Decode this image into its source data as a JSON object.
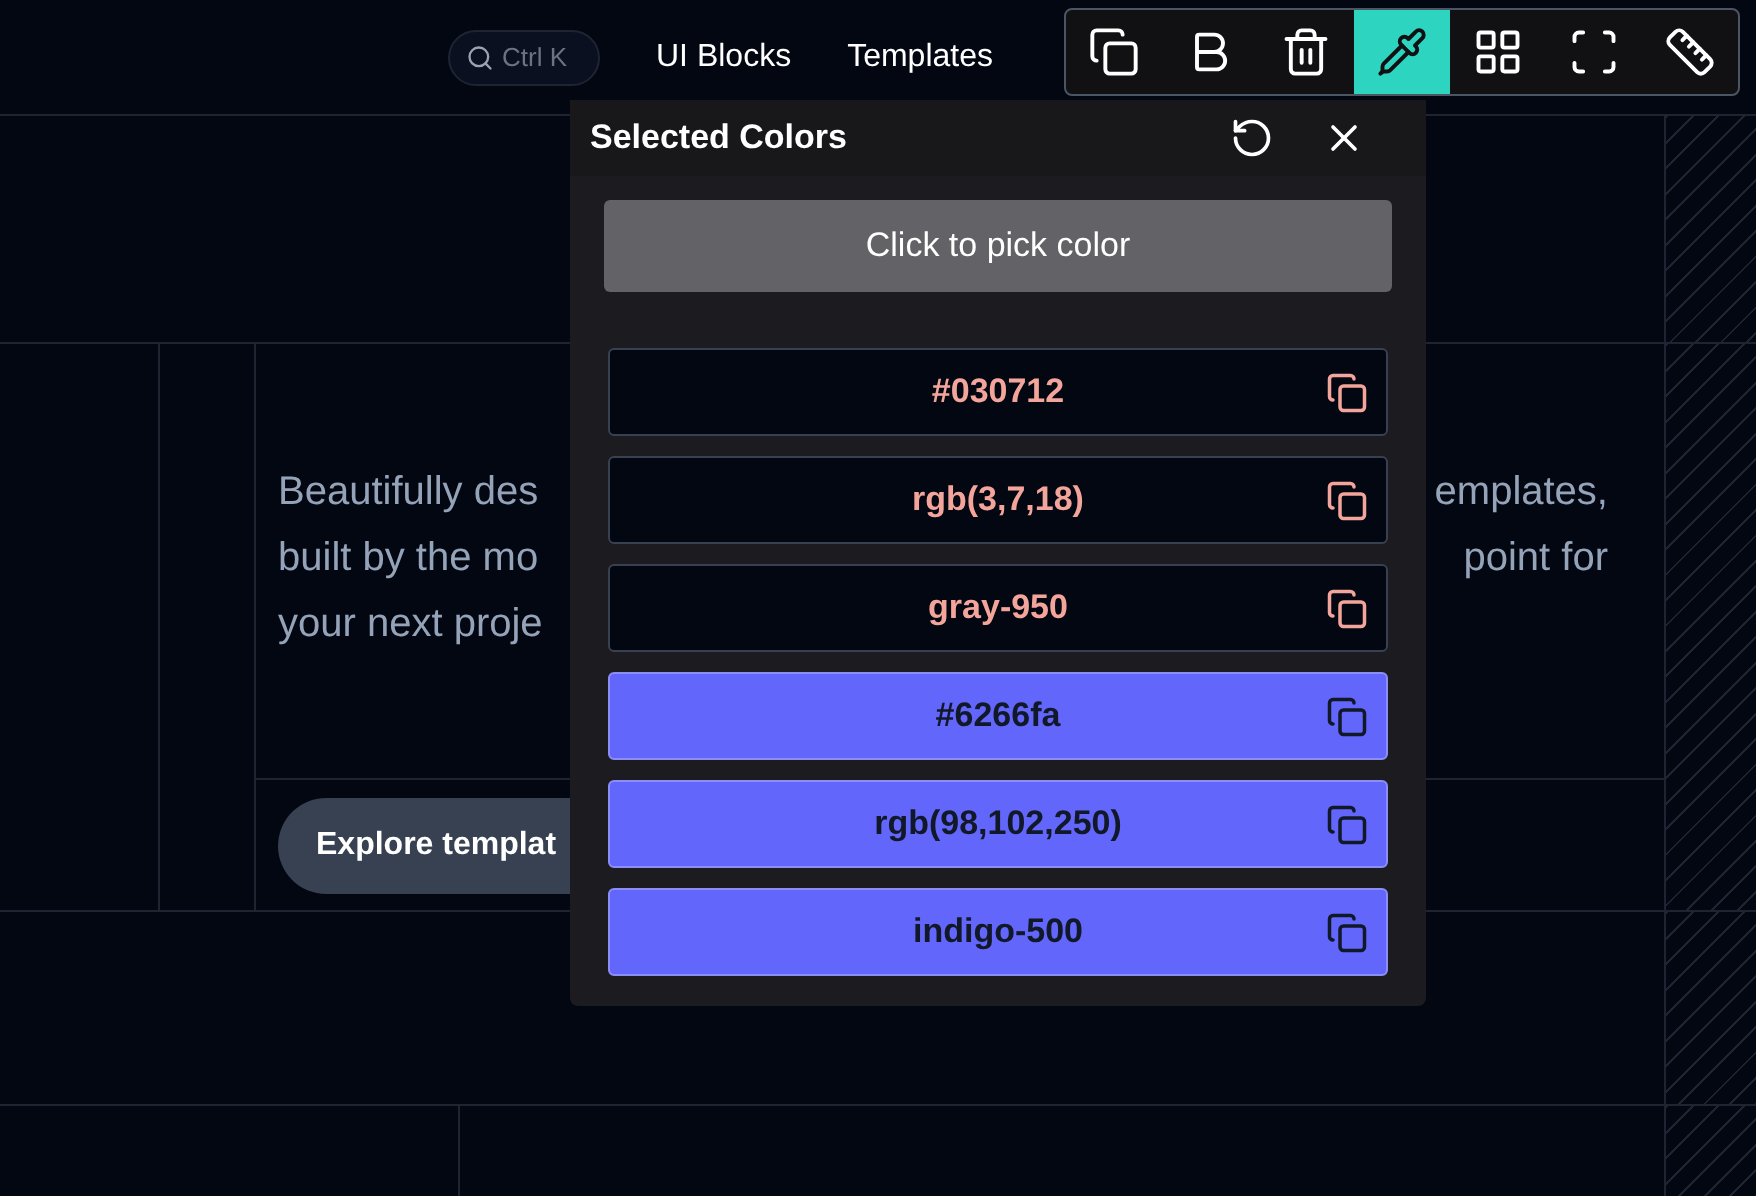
{
  "header": {
    "search": {
      "placeholder": "Ctrl K"
    },
    "nav": [
      "UI Blocks",
      "Templates"
    ]
  },
  "hero": {
    "left_lines": [
      "Beautifully des",
      "built by the mo",
      "your next proje"
    ],
    "right_lines": [
      "emplates,",
      "point for"
    ],
    "button": "Explore templat"
  },
  "toolbar": {
    "tools": [
      {
        "kind": "copy",
        "selected": false
      },
      {
        "kind": "bold",
        "selected": false
      },
      {
        "kind": "trash",
        "selected": false
      },
      {
        "kind": "pipette",
        "selected": true
      },
      {
        "kind": "grid",
        "selected": false
      },
      {
        "kind": "frame",
        "selected": false
      },
      {
        "kind": "ruler",
        "selected": false
      }
    ]
  },
  "panel": {
    "title": "Selected Colors",
    "pick_button": "Click to pick color",
    "swatches": [
      {
        "text": "#030712",
        "color": "#030712"
      },
      {
        "text": "rgb(3,7,18)",
        "color": "#030712"
      },
      {
        "text": "gray-950",
        "color": "#030712"
      },
      {
        "text": "#6266fa",
        "color": "#6266fa"
      },
      {
        "text": "rgb(98,102,250)",
        "color": "#6266fa"
      },
      {
        "text": "indigo-500",
        "color": "#6266fa"
      }
    ]
  }
}
